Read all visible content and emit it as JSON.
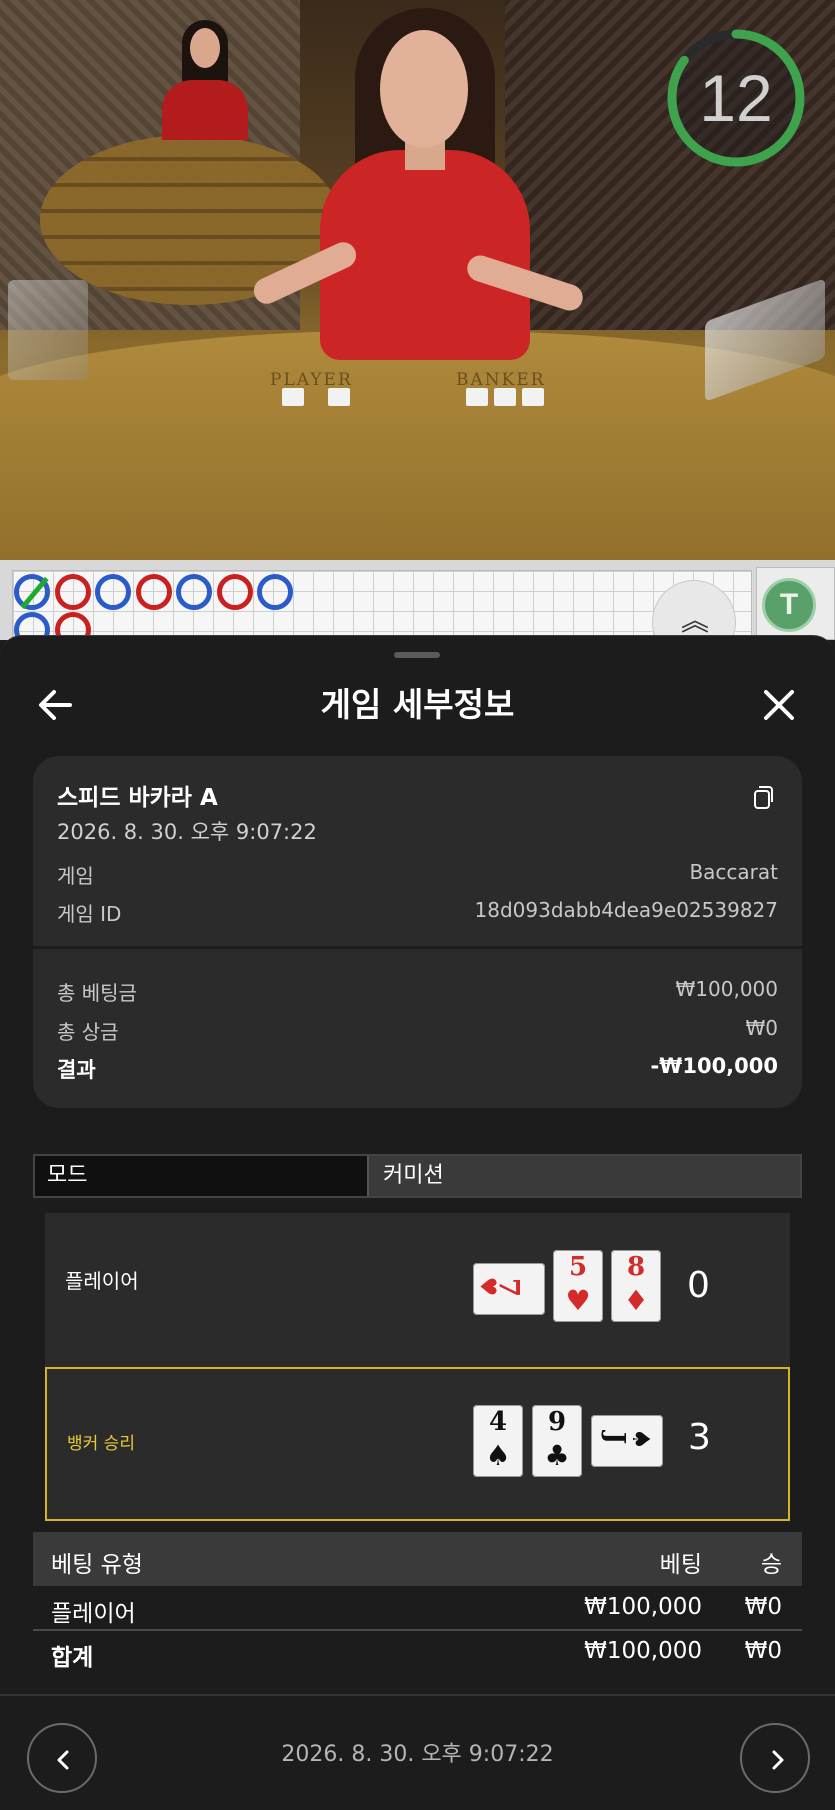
{
  "live": {
    "timer": "12",
    "timer_fraction": 0.85,
    "felt_player_text": "PLAYER",
    "felt_banker_text": "BANKER"
  },
  "roadmap": {
    "beads_row1": [
      "player-tie",
      "banker",
      "player",
      "banker",
      "player",
      "banker",
      "player"
    ],
    "beads_row2": [
      "player",
      "banker"
    ],
    "tie_badge": "T",
    "colors": {
      "banker": "#c9211f",
      "player": "#2b5bc8",
      "tie": "#1faa2f"
    }
  },
  "sheet": {
    "title": "게임 세부정보",
    "back_icon": "arrow-left-icon",
    "close_icon": "close-icon"
  },
  "summary": {
    "game_name": "스피드 바카라 A",
    "datetime": "2026. 8. 30. 오후 9:07:22",
    "game_label": "게임",
    "game_value": "Baccarat",
    "game_id_label": "게임 ID",
    "game_id_value": "18d093dabb4dea9e02539827",
    "total_bet_label": "총 베팅금",
    "total_bet_value": "₩100,000",
    "total_win_label": "총 상금",
    "total_win_value": "₩0",
    "result_label": "결과",
    "result_value": "-₩100,000"
  },
  "mode": {
    "label": "모드",
    "value": "커미션"
  },
  "hands": {
    "player": {
      "label": "플레이어",
      "score": "0",
      "cards": [
        {
          "rank": "7",
          "suit": "♥",
          "color": "red"
        },
        {
          "rank": "5",
          "suit": "♥",
          "color": "red"
        },
        {
          "rank": "8",
          "suit": "♦",
          "color": "red"
        }
      ]
    },
    "banker": {
      "label": "뱅커 승리",
      "score": "3",
      "cards": [
        {
          "rank": "4",
          "suit": "♠",
          "color": "black"
        },
        {
          "rank": "9",
          "suit": "♣",
          "color": "black"
        },
        {
          "rank": "J",
          "suit": "♠",
          "color": "black"
        }
      ]
    }
  },
  "bets": {
    "headers": {
      "type": "베팅 유형",
      "bet": "베팅",
      "win": "승"
    },
    "rows": [
      {
        "type": "플레이어",
        "bet": "₩100,000",
        "win": "₩0"
      }
    ],
    "total": {
      "type": "합계",
      "bet": "₩100,000",
      "win": "₩0"
    }
  },
  "footer": {
    "datetime": "2026. 8. 30. 오후 9:07:22"
  },
  "colors": {
    "winner_border": "#d7b425",
    "timer_ring": "#3fa34d"
  }
}
